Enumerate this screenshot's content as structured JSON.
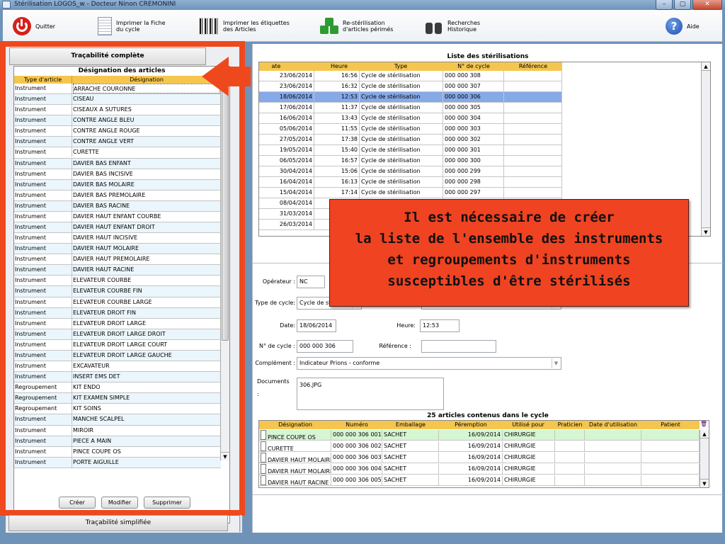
{
  "window": {
    "title": "Stérilisation  LOGOS_w - Docteur Ninon CREMONINI",
    "btn_min": "–",
    "btn_max": "▢",
    "btn_close": "✕"
  },
  "toolbar": {
    "quit": "Quitter",
    "print_sheet": "Imprimer la Fiche\ndu cycle",
    "print_labels": "Imprimer les étiquettes\ndes Articles",
    "resterilize": "Re-stérilisation\nd'articles périmés",
    "search": "Recherches\nHistorique",
    "help": "Aide",
    "help_glyph": "?"
  },
  "left": {
    "tab_complete": "Traçabilité complète",
    "list_title": "Désignation des articles",
    "col_type": "Type d'article",
    "col_designation": "Désignation",
    "header_icons": "🔍🗑",
    "items": [
      {
        "type": "Instrument",
        "name": "ARRACHE COURONNE"
      },
      {
        "type": "Instrument",
        "name": "CISEAU"
      },
      {
        "type": "Instrument",
        "name": "CISEAUX A SUTURES"
      },
      {
        "type": "Instrument",
        "name": "CONTRE ANGLE BLEU"
      },
      {
        "type": "Instrument",
        "name": "CONTRE ANGLE ROUGE"
      },
      {
        "type": "Instrument",
        "name": "CONTRE ANGLE VERT"
      },
      {
        "type": "Instrument",
        "name": "CURETTE"
      },
      {
        "type": "Instrument",
        "name": "DAVIER BAS ENFANT"
      },
      {
        "type": "Instrument",
        "name": "DAVIER BAS INCISIVE"
      },
      {
        "type": "Instrument",
        "name": "DAVIER BAS MOLAIRE"
      },
      {
        "type": "Instrument",
        "name": "DAVIER BAS PREMOLAIRE"
      },
      {
        "type": "Instrument",
        "name": "DAVIER BAS RACINE"
      },
      {
        "type": "Instrument",
        "name": "DAVIER HAUT ENFANT COURBE"
      },
      {
        "type": "Instrument",
        "name": "DAVIER HAUT ENFANT DROIT"
      },
      {
        "type": "Instrument",
        "name": "DAVIER HAUT INCISIVE"
      },
      {
        "type": "Instrument",
        "name": "DAVIER HAUT MOLAIRE"
      },
      {
        "type": "Instrument",
        "name": "DAVIER HAUT PREMOLAIRE"
      },
      {
        "type": "Instrument",
        "name": "DAVIER HAUT RACINE"
      },
      {
        "type": "Instrument",
        "name": "ELEVATEUR COURBE"
      },
      {
        "type": "Instrument",
        "name": "ELEVATEUR COURBE FIN"
      },
      {
        "type": "Instrument",
        "name": "ELEVATEUR COURBE LARGE"
      },
      {
        "type": "Instrument",
        "name": "ELEVATEUR DROIT FIN"
      },
      {
        "type": "Instrument",
        "name": "ELEVATEUR DROIT LARGE"
      },
      {
        "type": "Instrument",
        "name": "ELEVATEUR DROIT LARGE  DROIT"
      },
      {
        "type": "Instrument",
        "name": "ELEVATEUR DROIT LARGE COURT"
      },
      {
        "type": "Instrument",
        "name": "ELEVATEUR DROIT LARGE GAUCHE"
      },
      {
        "type": "Instrument",
        "name": "EXCAVATEUR"
      },
      {
        "type": "Instrument",
        "name": "INSERT EMS DET"
      },
      {
        "type": "Regroupement",
        "name": "KIT ENDO"
      },
      {
        "type": "Regroupement",
        "name": "KIT EXAMEN SIMPLE"
      },
      {
        "type": "Regroupement",
        "name": "KIT SOINS"
      },
      {
        "type": "Instrument",
        "name": "MANCHE SCALPEL"
      },
      {
        "type": "Instrument",
        "name": "MIROIR"
      },
      {
        "type": "Instrument",
        "name": "PIECE A MAIN"
      },
      {
        "type": "Instrument",
        "name": "PINCE COUPE OS"
      },
      {
        "type": "Instrument",
        "name": "PORTE AIGUILLE"
      }
    ],
    "btn_create": "Créer",
    "btn_modify": "Modifier",
    "btn_delete": "Supprimer",
    "tab_simple": "Traçabilité simplifiée"
  },
  "sterilizations": {
    "title": "Liste des stérilisations",
    "columns": [
      "ate",
      "Heure",
      "Type",
      "N° de cycle",
      "Référence"
    ],
    "rows": [
      {
        "date": "23/06/2014",
        "time": "16:56",
        "type": "Cycle de stérilisation",
        "cycle": "000 000 308"
      },
      {
        "date": "23/06/2014",
        "time": "16:32",
        "type": "Cycle de stérilisation",
        "cycle": "000 000 307"
      },
      {
        "date": "18/06/2014",
        "time": "12:53",
        "type": "Cycle de stérilisation",
        "cycle": "000 000 306"
      },
      {
        "date": "17/06/2014",
        "time": "11:37",
        "type": "Cycle de stérilisation",
        "cycle": "000 000 305"
      },
      {
        "date": "16/06/2014",
        "time": "13:43",
        "type": "Cycle de stérilisation",
        "cycle": "000 000 304"
      },
      {
        "date": "05/06/2014",
        "time": "11:55",
        "type": "Cycle de stérilisation",
        "cycle": "000 000 303"
      },
      {
        "date": "27/05/2014",
        "time": "17:38",
        "type": "Cycle de stérilisation",
        "cycle": "000 000 302"
      },
      {
        "date": "19/05/2014",
        "time": "15:40",
        "type": "Cycle de stérilisation",
        "cycle": "000 000 301"
      },
      {
        "date": "06/05/2014",
        "time": "16:57",
        "type": "Cycle de stérilisation",
        "cycle": "000 000 300"
      },
      {
        "date": "30/04/2014",
        "time": "15:06",
        "type": "Cycle de stérilisation",
        "cycle": "000 000 299"
      },
      {
        "date": "16/04/2014",
        "time": "16:13",
        "type": "Cycle de stérilisation",
        "cycle": "000 000 298"
      },
      {
        "date": "15/04/2014",
        "time": "17:14",
        "type": "Cycle de stérilisation",
        "cycle": "000 000 297"
      },
      {
        "date": "08/04/2014",
        "time": "",
        "type": "",
        "cycle": ""
      },
      {
        "date": "31/03/2014",
        "time": "",
        "type": "",
        "cycle": ""
      },
      {
        "date": "26/03/2014",
        "time": "",
        "type": "",
        "cycle": ""
      }
    ]
  },
  "form": {
    "operator_label": "Opérateur :",
    "operator_value": "NC",
    "cycle_type_label": "Type de cycle:",
    "cycle_type_value": "Cycle de st",
    "date_label": "Date:",
    "date_value": "18/06/2014",
    "time_label": "Heure:",
    "time_value": "12:53",
    "cycle_no_label": "N° de cycle :",
    "cycle_no_value": "000 000 306",
    "reference_label": "Référence :",
    "reference_value": "",
    "complement_label": "Complément :",
    "complement_value": "Indicateur Prions - conforme",
    "documents_label": "Documents :",
    "documents_value": "306.JPG"
  },
  "articles": {
    "title": "25 articles contenus dans le cycle",
    "columns": [
      "Désignation",
      "Numéro",
      "Emballage",
      "Péremption",
      "Utilisé pour",
      "Praticien",
      "Date d'utilisation",
      "Patient"
    ],
    "rows": [
      {
        "designation": "PINCE COUPE OS",
        "number": "000 000 306 001",
        "packaging": "SACHET",
        "expiry": "16/09/2014",
        "used_for": "CHIRURGIE"
      },
      {
        "designation": "CURETTE",
        "number": "000 000 306 002",
        "packaging": "SACHET",
        "expiry": "16/09/2014",
        "used_for": "CHIRURGIE"
      },
      {
        "designation": "DAVIER HAUT MOLAIRE",
        "number": "000 000 306 003",
        "packaging": "SACHET",
        "expiry": "16/09/2014",
        "used_for": "CHIRURGIE"
      },
      {
        "designation": "DAVIER HAUT MOLAIRE",
        "number": "000 000 306 004",
        "packaging": "SACHET",
        "expiry": "16/09/2014",
        "used_for": "CHIRURGIE"
      },
      {
        "designation": "DAVIER HAUT RACINE",
        "number": "000 000 306 005",
        "packaging": "SACHET",
        "expiry": "16/09/2014",
        "used_for": "CHIRURGIE"
      }
    ]
  },
  "callout": {
    "lines": [
      "Il est nécessaire de créer",
      "la liste de l'ensemble des instruments",
      "et regroupements d'instruments",
      "susceptibles d'être stérilisés"
    ]
  },
  "colors": {
    "accent_red": "#f0481d",
    "header_yellow": "#f5c64f",
    "selected_blue": "#86a9e8"
  }
}
